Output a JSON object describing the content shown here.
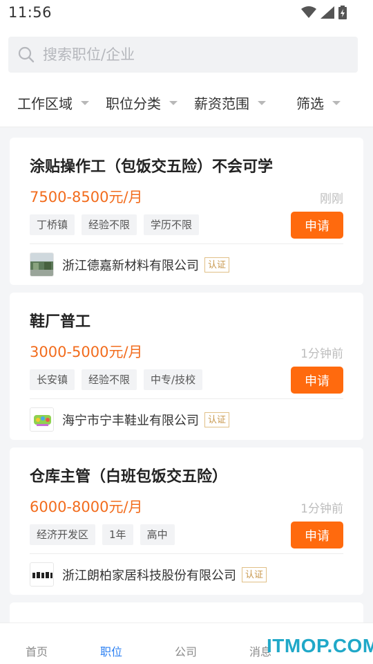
{
  "status_bar": {
    "time": "11:56"
  },
  "search": {
    "placeholder": "搜索职位/企业"
  },
  "filters": [
    {
      "label": "工作区域"
    },
    {
      "label": "职位分类"
    },
    {
      "label": "薪资范围"
    },
    {
      "label": "筛选"
    }
  ],
  "jobs": [
    {
      "title": "涂贴操作工（包饭交五险）不会可学",
      "salary": "7500-8500元/月",
      "posted": "刚刚",
      "tags": [
        "丁桥镇",
        "经验不限",
        "学历不限"
      ],
      "apply_label": "申请",
      "company": "浙江德嘉新材料有限公司",
      "badge": "认证"
    },
    {
      "title": "鞋厂普工",
      "salary": "3000-5000元/月",
      "posted": "1分钟前",
      "tags": [
        "长安镇",
        "经验不限",
        "中专/技校"
      ],
      "apply_label": "申请",
      "company": "海宁市宁丰鞋业有限公司",
      "badge": "认证"
    },
    {
      "title": "仓库主管（白班包饭交五险）",
      "salary": "6000-8000元/月",
      "posted": "1分钟前",
      "tags": [
        "经济开发区",
        "1年",
        "高中"
      ],
      "apply_label": "申请",
      "company": "浙江朗柏家居科技股份有限公司",
      "badge": "认证"
    }
  ],
  "tabs": [
    {
      "label": "首页"
    },
    {
      "label": "职位"
    },
    {
      "label": "公司"
    },
    {
      "label": "消息"
    }
  ],
  "watermark": "ITMOP.COM",
  "colors": {
    "accent": "#ff6a0e",
    "salary": "#f26c1d",
    "tab_active": "#2a7ff2",
    "verified": "#c7964a"
  }
}
